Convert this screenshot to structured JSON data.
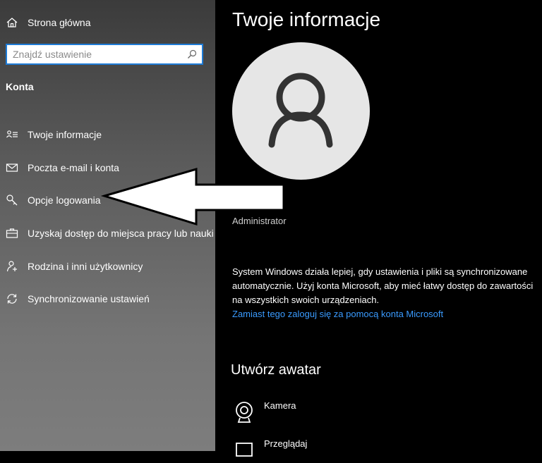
{
  "sidebar": {
    "home_label": "Strona główna",
    "search_placeholder": "Znajdź ustawienie",
    "section_title": "Konta",
    "items": [
      {
        "label": "Twoje informacje",
        "icon": "user-info-icon"
      },
      {
        "label": "Poczta e-mail i konta",
        "icon": "mail-icon"
      },
      {
        "label": "Opcje logowania",
        "icon": "key-icon"
      },
      {
        "label": "Uzyskaj dostęp do miejsca pracy lub nauki",
        "icon": "briefcase-icon"
      },
      {
        "label": "Rodzina i inni użytkownicy",
        "icon": "add-user-icon"
      },
      {
        "label": "Synchronizowanie ustawień",
        "icon": "sync-icon"
      }
    ]
  },
  "main": {
    "title": "Twoje informacje",
    "account_type": "Administrator",
    "description": "System Windows działa lepiej, gdy ustawienia i pliki są synchronizowane automatycznie. Użyj konta Microsoft, aby mieć łatwy dostęp do zawartości na wszystkich swoich urządzeniach.",
    "ms_link": "Zamiast tego zaloguj się za pomocą konta Microsoft",
    "avatar_heading": "Utwórz awatar",
    "avatar_options": [
      {
        "label": "Kamera",
        "icon": "camera-icon"
      },
      {
        "label": "Przeglądaj",
        "icon": "browse-icon"
      }
    ]
  },
  "colors": {
    "accent": "#1e7bd6",
    "link": "#3a9bff",
    "background": "#000000",
    "arrow": "#ffffff"
  }
}
